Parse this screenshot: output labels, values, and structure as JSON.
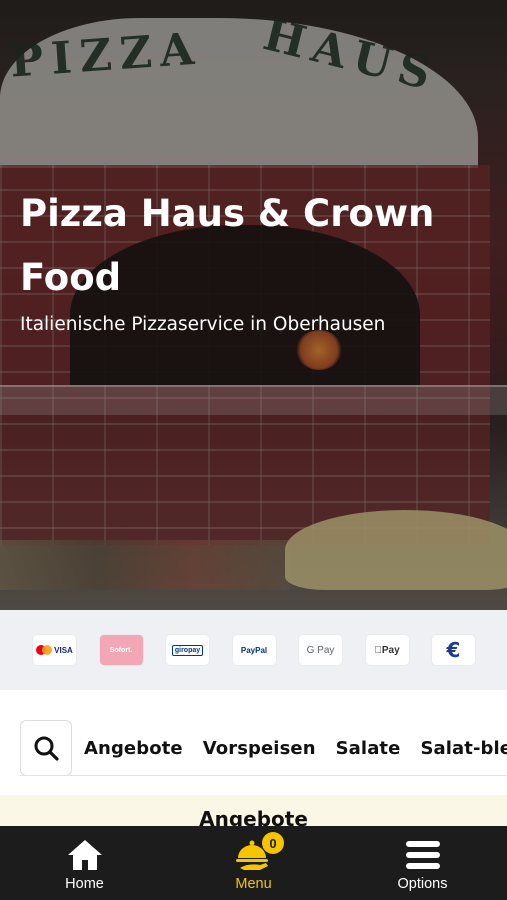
{
  "hero": {
    "sign_left": "PIZZA",
    "sign_right": "HAUS",
    "title": "Pizza Haus & Crown Food",
    "subtitle": "Italienische Pizzaservice in Oberhausen"
  },
  "payments": [
    {
      "name": "mastercard-visa",
      "label": "VISA"
    },
    {
      "name": "sofort",
      "label": "Sofort."
    },
    {
      "name": "giropay",
      "label": "giropay"
    },
    {
      "name": "paypal",
      "label": "PayPal"
    },
    {
      "name": "google-pay",
      "label": "G Pay"
    },
    {
      "name": "apple-pay",
      "label": "Pay"
    },
    {
      "name": "cash-euro",
      "label": "€"
    }
  ],
  "categories": {
    "search_icon": "search-icon",
    "tabs": [
      "Angebote",
      "Vorspeisen",
      "Salate",
      "Salat-bleche"
    ]
  },
  "section": {
    "title": "Angebote"
  },
  "bottom_nav": {
    "items": [
      {
        "label": "Home",
        "icon": "home-icon"
      },
      {
        "label": "Menu",
        "icon": "cloche-icon"
      },
      {
        "label": "Options",
        "icon": "hamburger-icon"
      }
    ],
    "cart_count": "0",
    "active_color": "#f5c500"
  }
}
